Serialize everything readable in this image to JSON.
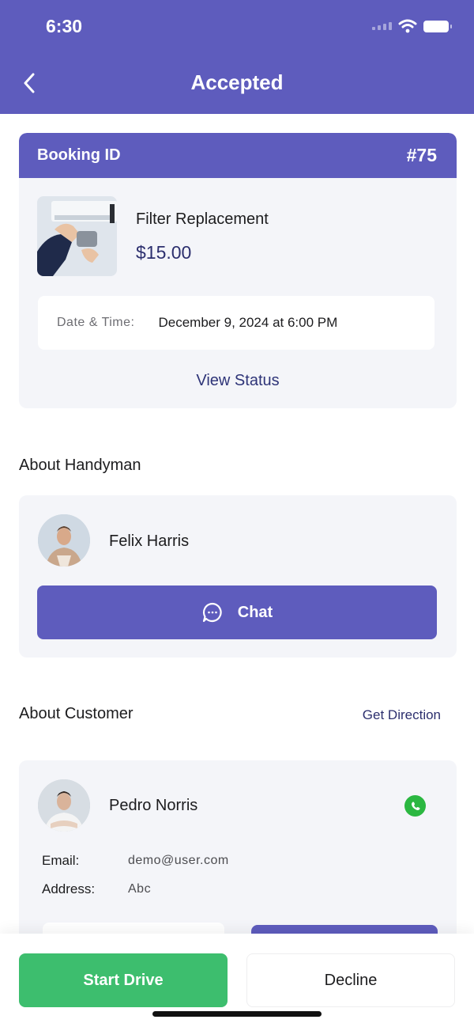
{
  "colors": {
    "primary": "#5e5cbd",
    "success": "#3dbe6e",
    "whatsapp": "#2bb741"
  },
  "status_bar": {
    "time": "6:30",
    "icons": [
      "wifi-icon",
      "battery-icon"
    ]
  },
  "header": {
    "title": "Accepted",
    "back_icon": "chevron-left-icon"
  },
  "booking": {
    "id_label": "Booking ID",
    "id_value": "#75",
    "service_name": "Filter Replacement",
    "price": "$15.00",
    "datetime_label": "Date & Time:",
    "datetime_value": "December 9, 2024 at 6:00 PM",
    "view_status": "View Status"
  },
  "handyman": {
    "section_title": "About Handyman",
    "name": "Felix Harris",
    "chat_label": "Chat",
    "chat_icon": "chat-bubble-icon"
  },
  "customer": {
    "section_title": "About Customer",
    "direction_link": "Get Direction",
    "name": "Pedro Norris",
    "contact_icon": "whatsapp-icon",
    "email_label": "Email:",
    "email_value": "demo@user.com",
    "address_label": "Address:",
    "address_value": "Abc"
  },
  "actions": {
    "start": "Start Drive",
    "decline": "Decline"
  }
}
